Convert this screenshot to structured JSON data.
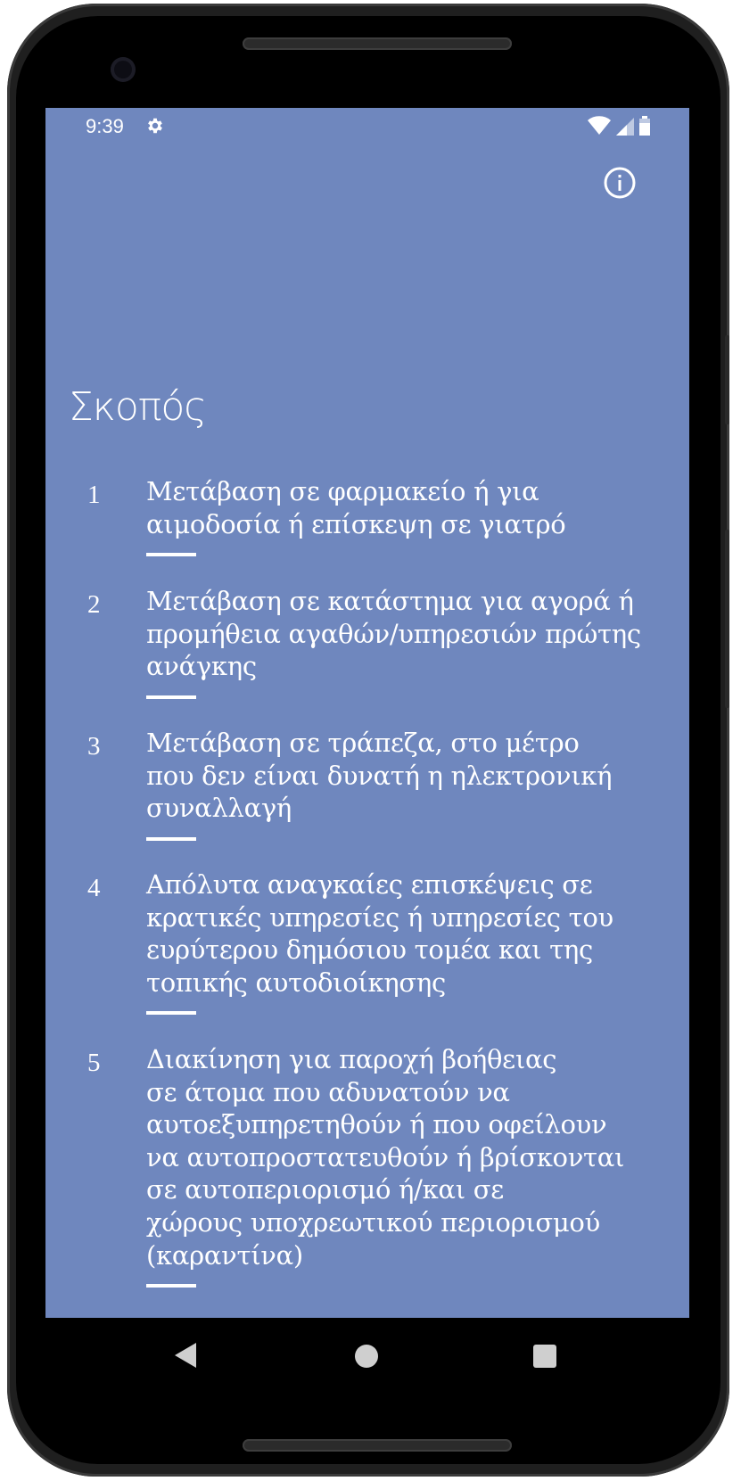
{
  "status_bar": {
    "time": "9:39",
    "icons": [
      "gear-icon",
      "wifi-icon",
      "signal-icon",
      "battery-icon"
    ]
  },
  "header": {
    "info_icon": "info-icon"
  },
  "page": {
    "title": "Σκοπός"
  },
  "purposes": [
    {
      "number": "1",
      "text": "Μετάβαση σε φαρμακείο ή για\nαιμοδοσία ή επίσκεψη σε γιατρό"
    },
    {
      "number": "2",
      "text": "Μετάβαση σε κατάστημα για αγορά ή\nπρομήθεια αγαθών/υπηρεσιών πρώτης\nανάγκης"
    },
    {
      "number": "3",
      "text": "Μετάβαση σε τράπεζα, στο μέτρο\nπου δεν είναι δυνατή η ηλεκτρονική\nσυναλλαγή"
    },
    {
      "number": "4",
      "text": "Απόλυτα αναγκαίες επισκέψεις σε\nκρατικές υπηρεσίες ή υπηρεσίες του\nευρύτερου δημόσιου τομέα και της\nτοπικής αυτοδιοίκησης"
    },
    {
      "number": "5",
      "text": "Διακίνηση για παροχή βοήθειας\nσε άτομα που αδυνατούν να\nαυτοεξυπηρετηθούν ή που οφείλουν\nνα αυτοπροστατευθούν ή βρίσκονται\nσε αυτοπεριορισμό ή/και σε\nχώρους υποχρεωτικού περιορισμού\n(καραντίνα)"
    }
  ],
  "navigation": {
    "icons": [
      "back-icon",
      "home-icon",
      "recents-icon"
    ]
  },
  "colors": {
    "screen_background": "#6f87be",
    "text": "#ffffff",
    "nav_background": "#000000"
  }
}
